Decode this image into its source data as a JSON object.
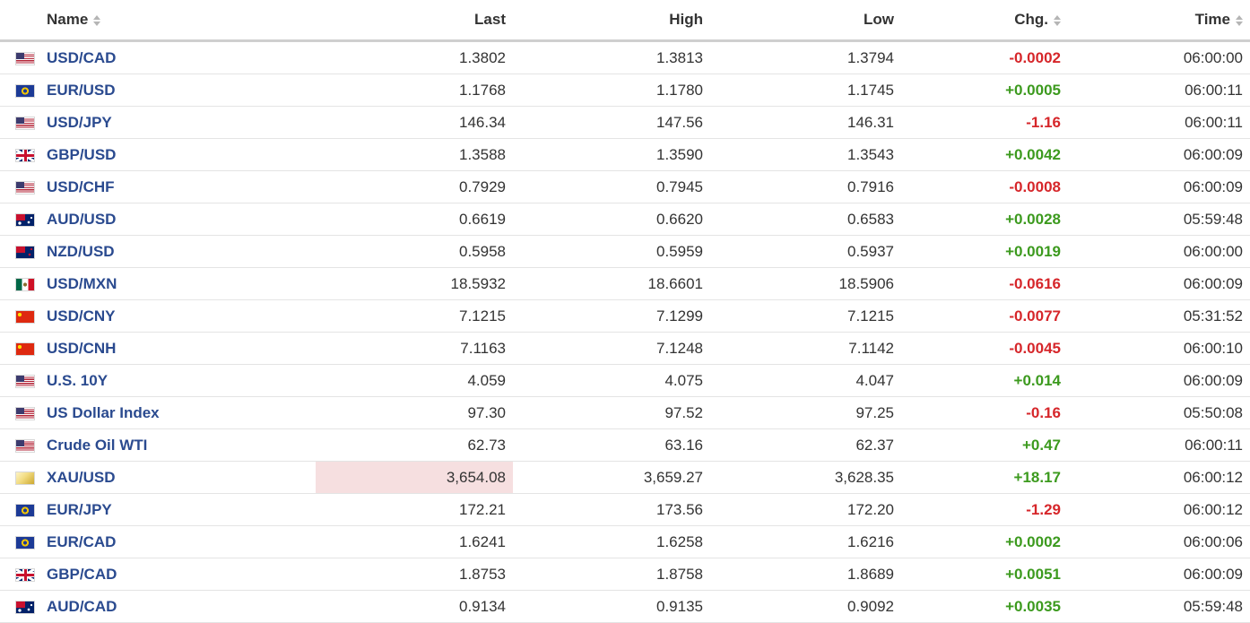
{
  "headers": {
    "name": "Name",
    "last": "Last",
    "high": "High",
    "low": "Low",
    "chg": "Chg.",
    "time": "Time"
  },
  "colors": {
    "link": "#2a4a8f",
    "positive": "#3c9a1e",
    "negative": "#d6262a",
    "highlight": "#f6dfe0"
  },
  "rows": [
    {
      "flag": "us-flag-icon",
      "name": "USD/CAD",
      "last": "1.3802",
      "high": "1.3813",
      "low": "1.3794",
      "chg": "-0.0002",
      "time": "06:00:00"
    },
    {
      "flag": "eu-flag-icon",
      "name": "EUR/USD",
      "last": "1.1768",
      "high": "1.1780",
      "low": "1.1745",
      "chg": "+0.0005",
      "time": "06:00:11"
    },
    {
      "flag": "us-flag-icon",
      "name": "USD/JPY",
      "last": "146.34",
      "high": "147.56",
      "low": "146.31",
      "chg": "-1.16",
      "time": "06:00:11"
    },
    {
      "flag": "gb-flag-icon",
      "name": "GBP/USD",
      "last": "1.3588",
      "high": "1.3590",
      "low": "1.3543",
      "chg": "+0.0042",
      "time": "06:00:09"
    },
    {
      "flag": "us-flag-icon",
      "name": "USD/CHF",
      "last": "0.7929",
      "high": "0.7945",
      "low": "0.7916",
      "chg": "-0.0008",
      "time": "06:00:09"
    },
    {
      "flag": "au-flag-icon",
      "name": "AUD/USD",
      "last": "0.6619",
      "high": "0.6620",
      "low": "0.6583",
      "chg": "+0.0028",
      "time": "05:59:48"
    },
    {
      "flag": "nz-flag-icon",
      "name": "NZD/USD",
      "last": "0.5958",
      "high": "0.5959",
      "low": "0.5937",
      "chg": "+0.0019",
      "time": "06:00:00"
    },
    {
      "flag": "mx-flag-icon",
      "name": "USD/MXN",
      "last": "18.5932",
      "high": "18.6601",
      "low": "18.5906",
      "chg": "-0.0616",
      "time": "06:00:09"
    },
    {
      "flag": "cn-flag-icon",
      "name": "USD/CNY",
      "last": "7.1215",
      "high": "7.1299",
      "low": "7.1215",
      "chg": "-0.0077",
      "time": "05:31:52"
    },
    {
      "flag": "cn-flag-icon",
      "name": "USD/CNH",
      "last": "7.1163",
      "high": "7.1248",
      "low": "7.1142",
      "chg": "-0.0045",
      "time": "06:00:10"
    },
    {
      "flag": "us-flag-icon",
      "name": "U.S. 10Y",
      "last": "4.059",
      "high": "4.075",
      "low": "4.047",
      "chg": "+0.014",
      "time": "06:00:09"
    },
    {
      "flag": "us-flag-icon",
      "name": "US Dollar Index",
      "last": "97.30",
      "high": "97.52",
      "low": "97.25",
      "chg": "-0.16",
      "time": "05:50:08"
    },
    {
      "flag": "us-flag-icon",
      "name": "Crude Oil WTI",
      "last": "62.73",
      "high": "63.16",
      "low": "62.37",
      "chg": "+0.47",
      "time": "06:00:11"
    },
    {
      "flag": "gold-icon",
      "name": "XAU/USD",
      "last": "3,654.08",
      "high": "3,659.27",
      "low": "3,628.35",
      "chg": "+18.17",
      "time": "06:00:12",
      "highlight_last": true
    },
    {
      "flag": "eu-flag-icon",
      "name": "EUR/JPY",
      "last": "172.21",
      "high": "173.56",
      "low": "172.20",
      "chg": "-1.29",
      "time": "06:00:12"
    },
    {
      "flag": "eu-flag-icon",
      "name": "EUR/CAD",
      "last": "1.6241",
      "high": "1.6258",
      "low": "1.6216",
      "chg": "+0.0002",
      "time": "06:00:06"
    },
    {
      "flag": "gb-flag-icon",
      "name": "GBP/CAD",
      "last": "1.8753",
      "high": "1.8758",
      "low": "1.8689",
      "chg": "+0.0051",
      "time": "06:00:09"
    },
    {
      "flag": "au-flag-icon",
      "name": "AUD/CAD",
      "last": "0.9134",
      "high": "0.9135",
      "low": "0.9092",
      "chg": "+0.0035",
      "time": "05:59:48"
    }
  ]
}
